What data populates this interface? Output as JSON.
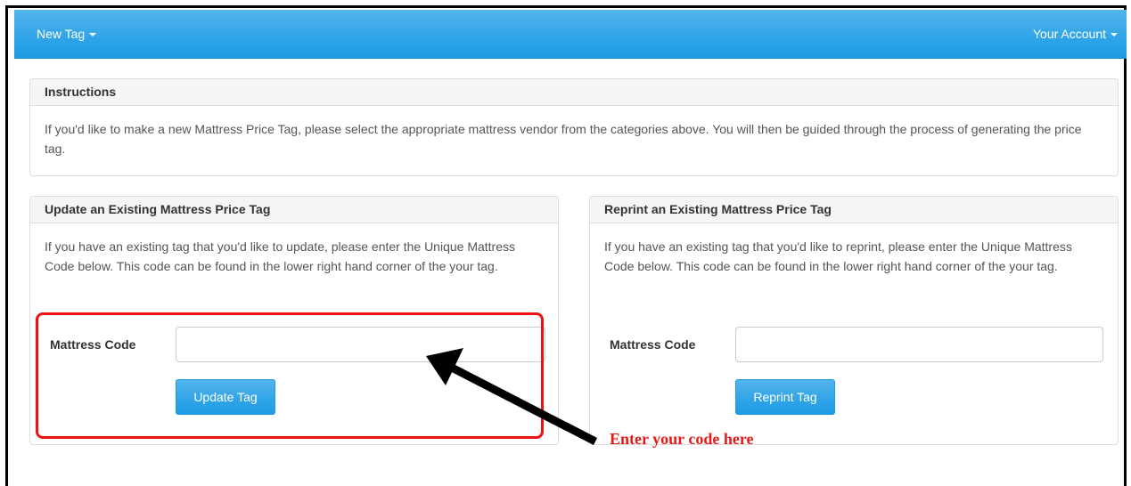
{
  "navbar": {
    "new_tag_label": "New Tag",
    "account_label": "Your Account"
  },
  "instructions": {
    "title": "Instructions",
    "body": "If you'd like to make a new Mattress Price Tag, please select the appropriate mattress vendor from the categories above. You will then be guided through the process of generating the price tag."
  },
  "update_panel": {
    "title": "Update an Existing Mattress Price Tag",
    "body": "If you have an existing tag that you'd like to update, please enter the Unique Mattress Code below. This code can be found in the lower right hand corner of the your tag.",
    "field_label": "Mattress Code",
    "field_value": "",
    "button_label": "Update Tag"
  },
  "reprint_panel": {
    "title": "Reprint an Existing Mattress Price Tag",
    "body": "If you have an existing tag that you'd like to reprint, please enter the Unique Mattress Code below. This code can be found in the lower right hand corner of the your tag.",
    "field_label": "Mattress Code",
    "field_value": "",
    "button_label": "Reprint Tag"
  },
  "annotation": {
    "text": "Enter your code here",
    "color": "#e31b1b"
  },
  "colors": {
    "navbar": "#2fa4e7",
    "button": "#2fa4e7",
    "highlight": "#ee1111"
  }
}
